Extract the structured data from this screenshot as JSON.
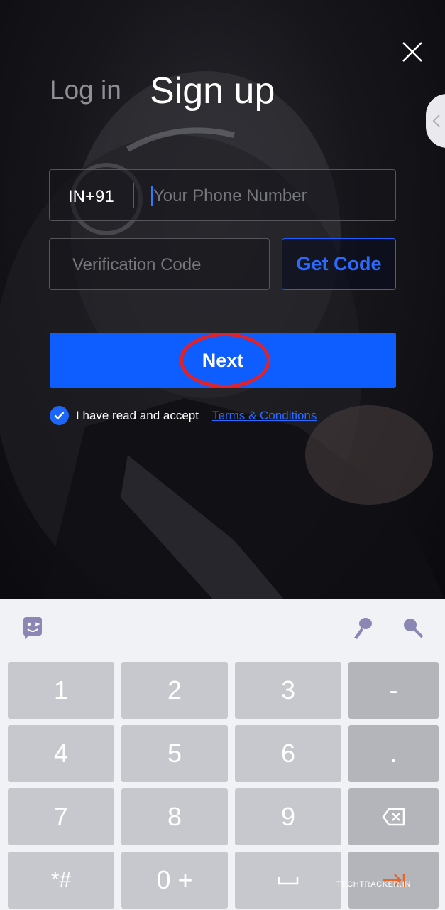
{
  "header": {
    "login_tab": "Log in",
    "signup_tab": "Sign up"
  },
  "form": {
    "country_code": "IN+91",
    "phone_placeholder": "Your Phone Number",
    "phone_value": "",
    "code_placeholder": "Verification Code",
    "code_value": "",
    "get_code_label": "Get Code",
    "next_label": "Next"
  },
  "terms": {
    "checked": true,
    "text": "I have read and accept",
    "link": "Terms & Conditions"
  },
  "keyboard": {
    "rows": [
      [
        "1",
        "2",
        "3",
        "-"
      ],
      [
        "4",
        "5",
        "6",
        "."
      ],
      [
        "7",
        "8",
        "9",
        "backspace-icon"
      ],
      [
        "*#",
        "0 +",
        "space-icon",
        "enter-icon"
      ]
    ],
    "toolbar_icons": [
      "emoji-icon",
      "microphone-icon",
      "search-icon"
    ]
  },
  "colors": {
    "accent": "#0d5dff",
    "highlight_circle": "#e0222a",
    "link": "#2a6bff"
  },
  "watermark": "TECHTRACKER.IN"
}
